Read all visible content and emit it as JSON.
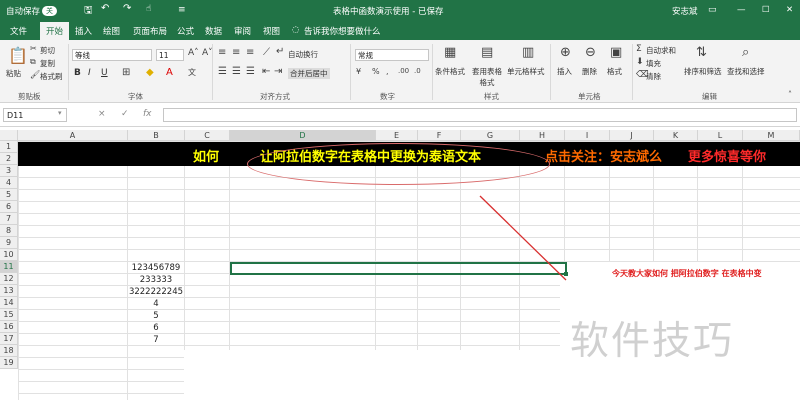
{
  "titlebar": {
    "autosave": "自动保存",
    "autosave_state": "关",
    "doc_title": "表格中函数演示使用 - 已保存",
    "user": "安志斌"
  },
  "tabs": [
    "文件",
    "开始",
    "插入",
    "绘图",
    "页面布局",
    "公式",
    "数据",
    "审阅",
    "视图"
  ],
  "tell_me": "告诉我你想要做什么",
  "ribbon": {
    "clipboard": {
      "paste": "粘贴",
      "cut": "剪切",
      "copy": "复制",
      "format_painter": "格式刷",
      "label": "剪贴板"
    },
    "font": {
      "name": "等线",
      "size": "11",
      "label": "字体",
      "bold": "B",
      "italic": "I",
      "underline": "U"
    },
    "alignment": {
      "wrap": "自动换行",
      "merge": "合并后居中",
      "label": "对齐方式"
    },
    "number": {
      "format": "常规",
      "label": "数字"
    },
    "styles": {
      "conditional": "条件格式",
      "table": "套用表格格式",
      "cell_styles": "单元格样式",
      "label": "样式"
    },
    "cells": {
      "insert": "插入",
      "delete": "删除",
      "format": "格式",
      "label": "单元格"
    },
    "editing": {
      "autosum": "自动求和",
      "fill": "填充",
      "clear": "清除",
      "sort": "排序和筛选",
      "find": "查找和选择",
      "label": "编辑"
    }
  },
  "formula_bar": {
    "name_box": "D11",
    "cancel": "×",
    "enter": "✓",
    "fx": "fx",
    "value": ""
  },
  "columns": [
    "A",
    "B",
    "C",
    "D",
    "E",
    "F",
    "G",
    "H",
    "I",
    "J",
    "K",
    "L",
    "M"
  ],
  "selected_column": "D",
  "rows": [
    "1",
    "2",
    "3",
    "4",
    "5",
    "6",
    "7",
    "8",
    "9",
    "10",
    "11",
    "12",
    "13",
    "14",
    "15",
    "16",
    "17",
    "18",
    "19"
  ],
  "selected_row": "11",
  "banner": {
    "part1": "如何",
    "part2": "让阿拉伯数字在表格中更换为泰语文本",
    "part3": "点击关注：安志斌么",
    "part4": "更多惊喜等你"
  },
  "cells_b": [
    "123456789",
    "233333",
    "3222222245",
    "4",
    "5",
    "6",
    "7"
  ],
  "note": "今天教大家如何 把阿拉伯数字 在表格中变",
  "watermark": "软件技巧",
  "colors": {
    "excel_green": "#217346",
    "banner_yellow": "#ffff00",
    "banner_orange": "#ff6a00",
    "banner_red": "#ff2a2a"
  }
}
